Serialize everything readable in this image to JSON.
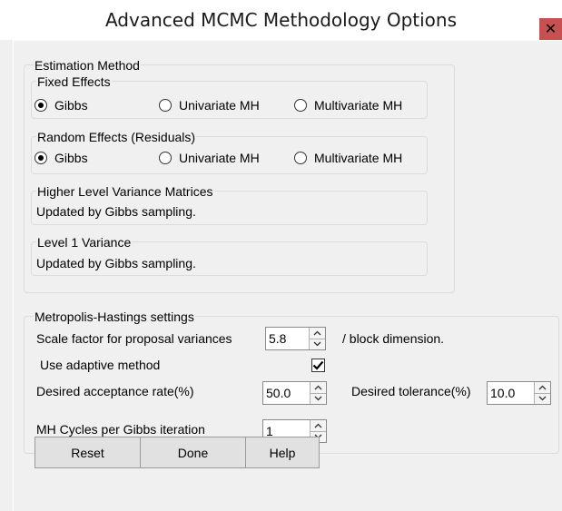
{
  "window": {
    "title": "Advanced MCMC Methodology Options",
    "close_glyph": "✕"
  },
  "estimation": {
    "label": "Estimation Method",
    "fixed": {
      "label": "Fixed Effects",
      "options": [
        "Gibbs",
        "Univariate MH",
        "Multivariate MH"
      ],
      "selected": "Gibbs"
    },
    "random": {
      "label": "Random Effects (Residuals)",
      "options": [
        "Gibbs",
        "Univariate MH",
        "Multivariate MH"
      ],
      "selected": "Gibbs"
    },
    "higher": {
      "label": "Higher Level  Variance Matrices",
      "text": "Updated by Gibbs sampling."
    },
    "level1": {
      "label": "Level 1 Variance",
      "text": "Updated by Gibbs sampling."
    }
  },
  "mh": {
    "label": "Metropolis-Hastings settings",
    "scale_label": "Scale factor for proposal variances",
    "scale_value": "5.8",
    "scale_suffix": "/ block dimension.",
    "adaptive_label": "Use adaptive method",
    "adaptive_checked": true,
    "acceptance_label": "Desired acceptance rate(%)",
    "acceptance_value": "50.0",
    "tolerance_label": "Desired tolerance(%)",
    "tolerance_value": "10.0",
    "cycles_label": "MH Cycles per Gibbs iteration",
    "cycles_value": "1"
  },
  "buttons": {
    "reset": "Reset",
    "done": "Done",
    "help": "Help"
  },
  "icons": {
    "close": "close-icon",
    "spin_up": "chevron-up-icon",
    "spin_down": "chevron-down-icon",
    "check": "check-icon"
  }
}
